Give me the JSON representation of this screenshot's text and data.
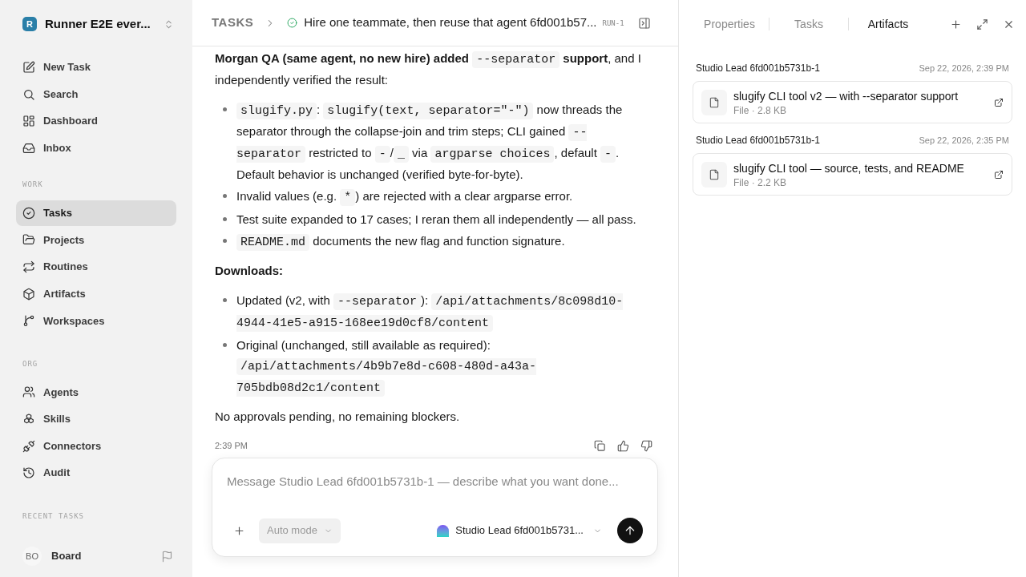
{
  "sidebar": {
    "workspace": {
      "logo_letter": "R",
      "name": "Runner E2E ever..."
    },
    "sections": [
      {
        "items": [
          {
            "label": "New Task",
            "selected": false
          },
          {
            "label": "Search",
            "selected": false
          },
          {
            "label": "Dashboard",
            "selected": false
          },
          {
            "label": "Inbox",
            "selected": false
          }
        ]
      },
      {
        "heading": "WORK",
        "items": [
          {
            "label": "Tasks",
            "selected": true
          },
          {
            "label": "Projects",
            "selected": false
          },
          {
            "label": "Routines",
            "selected": false
          },
          {
            "label": "Artifacts",
            "selected": false
          },
          {
            "label": "Workspaces",
            "selected": false
          }
        ]
      },
      {
        "heading": "ORG",
        "items": [
          {
            "label": "Agents",
            "selected": false
          },
          {
            "label": "Skills",
            "selected": false
          },
          {
            "label": "Connectors",
            "selected": false
          },
          {
            "label": "Audit",
            "selected": false
          }
        ]
      },
      {
        "heading": "RECENT TASKS"
      }
    ],
    "user": {
      "initials": "BO",
      "name": "Board"
    }
  },
  "header": {
    "breadcrumb": "TASKS",
    "title": "Hire one teammate, then reuse that agent 6fd001b57...",
    "run": "RUN-1"
  },
  "message": {
    "blocks": [
      {
        "kind": "paragraph",
        "parts": [
          {
            "kind": "bold",
            "text": "Morgan QA (same agent, no new hire) added "
          },
          {
            "kind": "code",
            "text": "--separator"
          },
          {
            "kind": "bold",
            "text": " support"
          },
          {
            "kind": "text",
            "text": ", and I independently verified the result:"
          }
        ]
      },
      {
        "kind": "list",
        "items": [
          [
            {
              "kind": "code",
              "text": "slugify.py"
            },
            {
              "kind": "text",
              "text": ": "
            },
            {
              "kind": "code",
              "text": "slugify(text, separator=\"-\")"
            },
            {
              "kind": "text",
              "text": " now threads the separator through the collapse-join and trim steps; CLI gained "
            },
            {
              "kind": "code",
              "text": "--separator"
            },
            {
              "kind": "text",
              "text": " restricted to "
            },
            {
              "kind": "code",
              "text": "-"
            },
            {
              "kind": "text",
              "text": "/"
            },
            {
              "kind": "code",
              "text": "_"
            },
            {
              "kind": "text",
              "text": " via "
            },
            {
              "kind": "code",
              "text": "argparse choices"
            },
            {
              "kind": "text",
              "text": ", default "
            },
            {
              "kind": "code",
              "text": "-"
            },
            {
              "kind": "text",
              "text": ". Default behavior is unchanged (verified byte-for-byte)."
            }
          ],
          [
            {
              "kind": "text",
              "text": "Invalid values (e.g. "
            },
            {
              "kind": "code",
              "text": "*"
            },
            {
              "kind": "text",
              "text": ") are rejected with a clear argparse error."
            }
          ],
          [
            {
              "kind": "text",
              "text": "Test suite expanded to 17 cases; I reran them all independently — all pass."
            }
          ],
          [
            {
              "kind": "code",
              "text": "README.md"
            },
            {
              "kind": "text",
              "text": " documents the new flag and function signature."
            }
          ]
        ]
      },
      {
        "kind": "paragraph",
        "parts": [
          {
            "kind": "bold",
            "text": "Downloads:"
          }
        ]
      },
      {
        "kind": "list",
        "items": [
          [
            {
              "kind": "text",
              "text": "Updated (v2, with "
            },
            {
              "kind": "code",
              "text": "--separator"
            },
            {
              "kind": "text",
              "text": "): "
            },
            {
              "kind": "code",
              "text": "/api/attachments/8c098d10-4944-41e5-a915-168ee19d0cf8/content"
            }
          ],
          [
            {
              "kind": "text",
              "text": "Original (unchanged, still available as required): "
            },
            {
              "kind": "code",
              "text": "/api/attachments/4b9b7e8d-c608-480d-a43a-705bdb08d2c1/content"
            }
          ]
        ]
      },
      {
        "kind": "paragraph",
        "parts": [
          {
            "kind": "text",
            "text": "No approvals pending, no remaining blockers."
          }
        ]
      }
    ],
    "time": "2:39 PM"
  },
  "composer": {
    "placeholder": "Message Studio Lead 6fd001b5731b-1 — describe what you want done...",
    "mode": "Auto mode",
    "agent": "Studio Lead 6fd001b5731..."
  },
  "panel": {
    "tabs": [
      {
        "label": "Properties",
        "selected": false
      },
      {
        "label": "Tasks",
        "selected": false
      },
      {
        "label": "Artifacts",
        "selected": true
      }
    ],
    "artifacts": [
      {
        "author": "Studio Lead 6fd001b5731b-1",
        "date": "Sep 22, 2026, 2:39 PM",
        "title": "slugify CLI tool v2 — with --separator support",
        "meta": "File · 2.8 KB"
      },
      {
        "author": "Studio Lead 6fd001b5731b-1",
        "date": "Sep 22, 2026, 2:35 PM",
        "title": "slugify CLI tool — source, tests, and README",
        "meta": "File · 2.2 KB"
      }
    ]
  }
}
